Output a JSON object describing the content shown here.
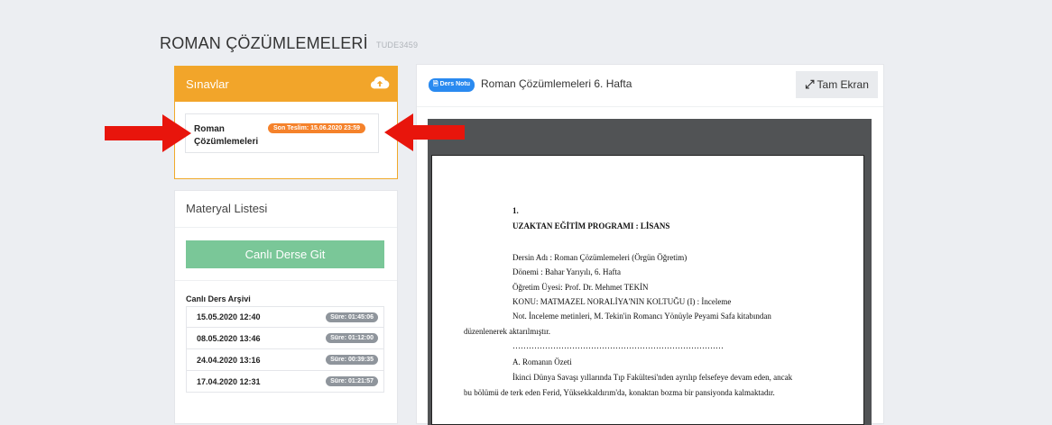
{
  "page": {
    "title": "ROMAN ÇÖZÜMLEMELERİ",
    "code": "TUDE3459"
  },
  "exams": {
    "header": "Sınavlar",
    "upload_icon": "cloud-upload-icon",
    "item": {
      "name": "Roman Çözümlemeleri",
      "deadline": "Son Teslim: 15.06.2020 23:59"
    }
  },
  "materials": {
    "title": "Materyal Listesi",
    "live_button": "Canlı Derse Git",
    "archive_title": "Canlı Ders Arşivi",
    "archive": [
      {
        "date": "15.05.2020 12:40",
        "duration": "Süre: 01:45:06"
      },
      {
        "date": "08.05.2020 13:46",
        "duration": "Süre: 01:12:00"
      },
      {
        "date": "24.04.2020 13:16",
        "duration": "Süre: 00:39:35"
      },
      {
        "date": "17.04.2020 12:31",
        "duration": "Süre: 01:21:57"
      }
    ]
  },
  "document": {
    "badge": "Ders Notu",
    "title": "Roman Çözümlemeleri 6. Hafta",
    "fullscreen": "Tam Ekran",
    "lines": {
      "num": "1.",
      "program": "UZAKTAN EĞİTİM PROGRAMI : LİSANS",
      "course": "Dersin Adı : Roman Çözümlemeleri (Örgün Öğretim)",
      "term": "Dönemi : Bahar Yarıyılı, 6. Hafta",
      "teacher": "Öğretim Üyesi: Prof. Dr. Mehmet TEKİN",
      "topic": "KONU: MATMAZEL NORALİYA'NIN KOLTUĞU (I) : İnceleme",
      "note1": "Not. İnceleme metinleri, M. Tekin'in Romancı Yönüyle Peyami Safa kitabından",
      "note2": "düzenlenerek aktarılmıştır.",
      "dots": "……………………………………………………………………",
      "section": "A.  Romanın Özeti",
      "summary1": "İkinci Dünya Savaşı yıllarında Tıp Fakültesi'nden ayrılıp felsefeye devam eden, ancak",
      "summary2": "bu bölümü de terk eden Ferid, Yüksekkaldırım'da, konaktan bozma bir pansiyonda kalmaktadır."
    }
  },
  "colors": {
    "orange": "#f2a52a",
    "deadline": "#f5822b",
    "green": "#7ac798",
    "blue_badge": "#2a8af0",
    "arrow": "#e8150c"
  }
}
